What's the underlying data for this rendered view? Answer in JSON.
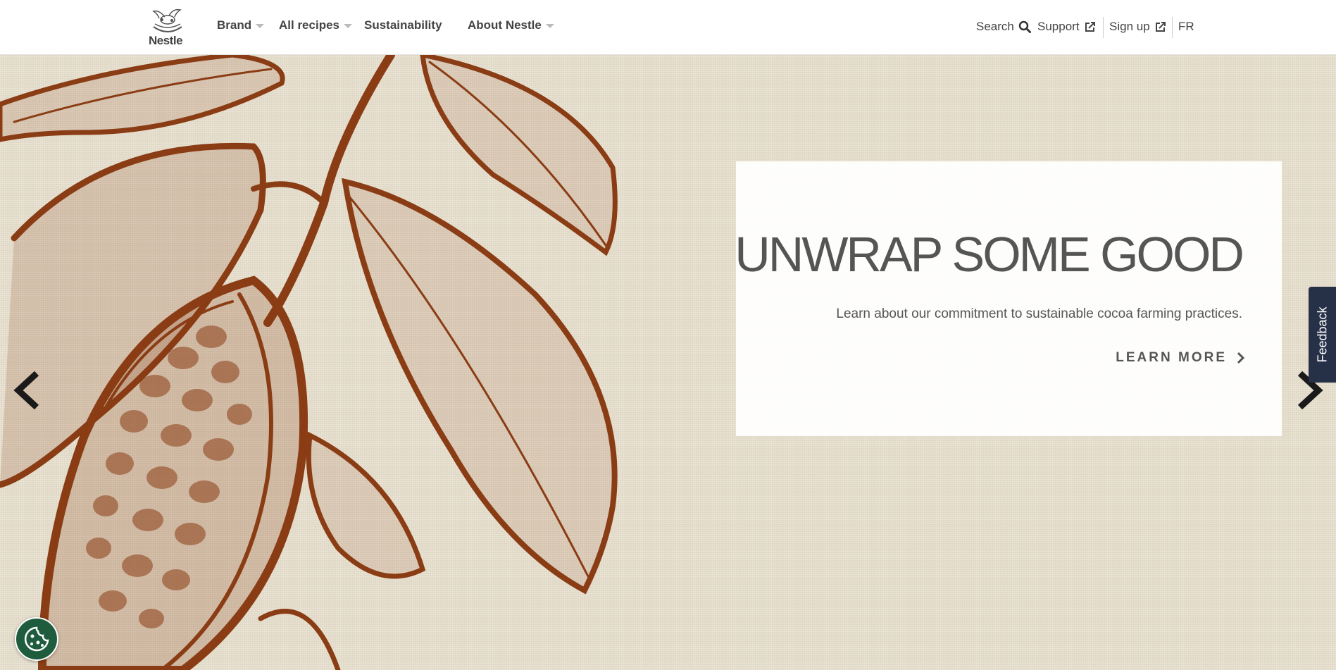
{
  "brand": {
    "logo_text": "Nestle"
  },
  "nav": {
    "items": [
      {
        "label": "Brand",
        "dropdown": true
      },
      {
        "label": "All recipes",
        "dropdown": true
      },
      {
        "label": "Sustainability",
        "dropdown": false
      },
      {
        "label": "About Nestle",
        "dropdown": true
      }
    ]
  },
  "utility": {
    "search_label": "Search",
    "support_label": "Support",
    "signup_label": "Sign up",
    "lang_label": "FR"
  },
  "hero": {
    "headline": "UNWRAP SOME GOOD",
    "subtext": "Learn about our commitment to sustainable cocoa farming practices.",
    "cta_label": "LEARN MORE"
  },
  "feedback_label": "Feedback",
  "colors": {
    "illustration": "#8a3c14",
    "hero_bg": "#e9e1cf",
    "feedback_bg": "#263148",
    "cookie_bg": "#1f5c3e"
  },
  "icons": [
    "search-icon",
    "external-link-icon",
    "chevron-right-icon",
    "chevron-left-icon",
    "cookie-icon"
  ]
}
